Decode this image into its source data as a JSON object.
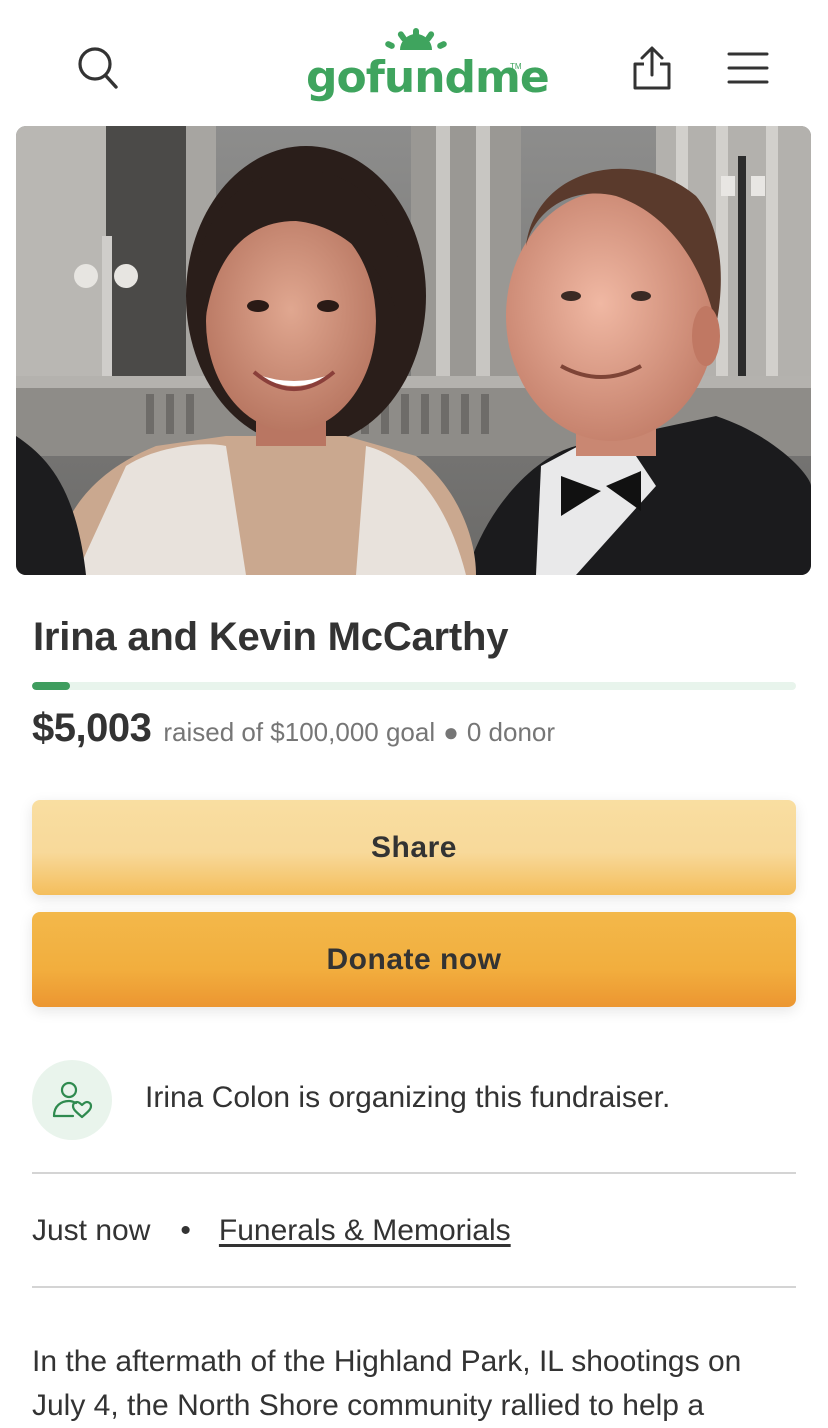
{
  "header": {
    "logo_text": "gofundme",
    "logo_tm": "TM",
    "icons": [
      "search-icon",
      "share-upload-icon",
      "hamburger-menu-icon"
    ]
  },
  "campaign": {
    "title": "Irina and Kevin McCarthy",
    "raised_amount": "$5,003",
    "raised_text": "raised of $100,000 goal",
    "bullet": "●",
    "donor_text": "0 donor",
    "progress_fraction": 0.05003
  },
  "buttons": {
    "share_label": "Share",
    "donate_label": "Donate now"
  },
  "organizer": {
    "text": "Irina Colon is organizing this fundraiser.",
    "icon": "person-heart-icon"
  },
  "meta": {
    "time": "Just now",
    "bullet": "•",
    "category": "Funerals & Memorials"
  },
  "story": {
    "text": "In the aftermath of the Highland Park, IL shootings on July 4, the North Shore community rallied to help a"
  },
  "colors": {
    "brand_green": "#3fa45e",
    "share_button": "#f8d99a",
    "donate_button": "#f2ae3e",
    "progress_track": "#e8f4ec"
  }
}
